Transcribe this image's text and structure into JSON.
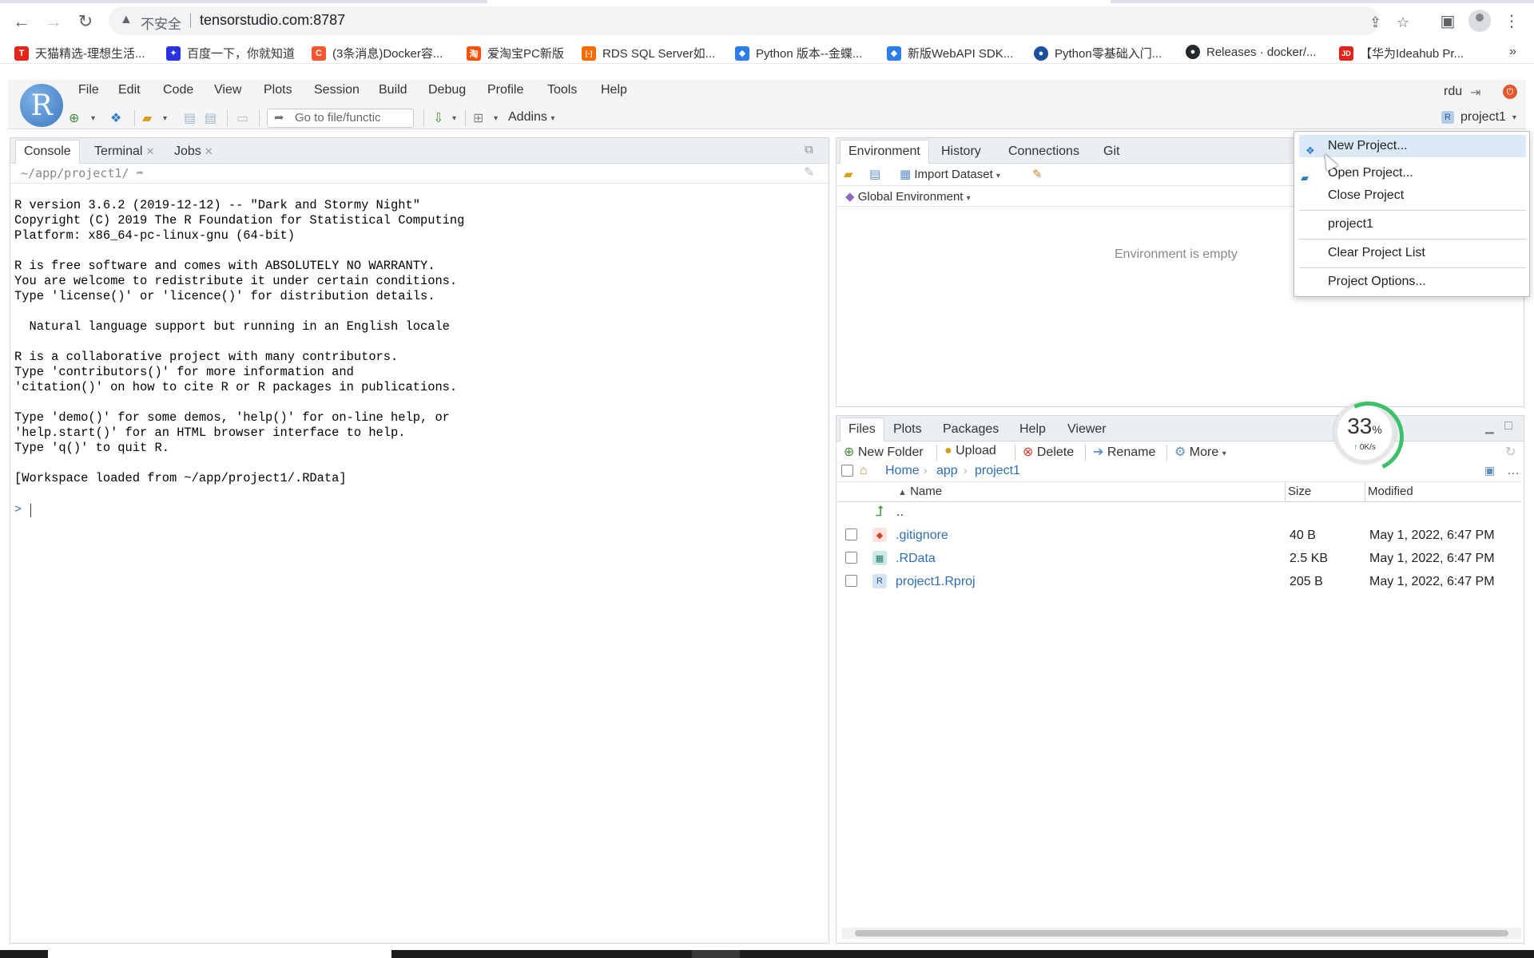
{
  "browser": {
    "insecure_label": "不安全",
    "url": "tensorstudio.com:8787",
    "bookmarks": [
      {
        "label": "天猫精选-理想生活...",
        "icon_text": "T",
        "color": "#e1251b"
      },
      {
        "label": "百度一下，你就知道",
        "icon_text": "✦",
        "color": "#2932e1"
      },
      {
        "label": "(3条消息)Docker容...",
        "icon_text": "C",
        "color": "#fc5531"
      },
      {
        "label": "爱淘宝PC新版",
        "icon_text": "淘",
        "color": "#ff5000"
      },
      {
        "label": "RDS SQL Server如...",
        "icon_text": "[-]",
        "color": "#ff6a00"
      },
      {
        "label": "Python 版本--金蝶...",
        "icon_text": "◆",
        "color": "#2b7de9"
      },
      {
        "label": "新版WebAPI SDK...",
        "icon_text": "◆",
        "color": "#2b7de9"
      },
      {
        "label": "Python零基础入门...",
        "icon_text": "●",
        "color": "#1b4fa0"
      },
      {
        "label": "Releases · docker/...",
        "icon_text": "●",
        "color": "#24292e"
      },
      {
        "label": "【华为Ideahub Pr...",
        "icon_text": "JD",
        "color": "#e1251b"
      }
    ],
    "more_bookmarks": "»"
  },
  "rstudio": {
    "logo": "R",
    "menu": [
      "File",
      "Edit",
      "Code",
      "View",
      "Plots",
      "Session",
      "Build",
      "Debug",
      "Profile",
      "Tools",
      "Help"
    ],
    "user": "rdu",
    "goto_placeholder": "Go to file/functic",
    "addins": "Addins",
    "project_name": "project1"
  },
  "console_pane": {
    "tabs": [
      {
        "label": "Console",
        "closable": false
      },
      {
        "label": "Terminal",
        "closable": true
      },
      {
        "label": "Jobs",
        "closable": true
      }
    ],
    "path": "~/app/project1/",
    "output": "R version 3.6.2 (2019-12-12) -- \"Dark and Stormy Night\"\nCopyright (C) 2019 The R Foundation for Statistical Computing\nPlatform: x86_64-pc-linux-gnu (64-bit)\n\nR is free software and comes with ABSOLUTELY NO WARRANTY.\nYou are welcome to redistribute it under certain conditions.\nType 'license()' or 'licence()' for distribution details.\n\n  Natural language support but running in an English locale\n\nR is a collaborative project with many contributors.\nType 'contributors()' for more information and\n'citation()' on how to cite R or R packages in publications.\n\nType 'demo()' for some demos, 'help()' for on-line help, or\n'help.start()' for an HTML browser interface to help.\nType 'q()' to quit R.\n\n[Workspace loaded from ~/app/project1/.RData]",
    "prompt": ">"
  },
  "env_pane": {
    "tabs": [
      "Environment",
      "History",
      "Connections",
      "Git"
    ],
    "import_dataset": "Import Dataset",
    "global_env": "Global Environment",
    "empty_message": "Environment is empty"
  },
  "files_pane": {
    "tabs": [
      "Files",
      "Plots",
      "Packages",
      "Help",
      "Viewer"
    ],
    "toolbar": {
      "new_folder": "New Folder",
      "upload": "Upload",
      "delete": "Delete",
      "rename": "Rename",
      "more": "More"
    },
    "breadcrumb": [
      "Home",
      "app",
      "project1"
    ],
    "columns": {
      "name": "Name",
      "size": "Size",
      "modified": "Modified"
    },
    "parent": "..",
    "files": [
      {
        "name": ".gitignore",
        "size": "40 B",
        "modified": "May 1, 2022, 6:47 PM"
      },
      {
        "name": ".RData",
        "size": "2.5 KB",
        "modified": "May 1, 2022, 6:47 PM"
      },
      {
        "name": "project1.Rproj",
        "size": "205 B",
        "modified": "May 1, 2022, 6:47 PM"
      }
    ]
  },
  "speed_widget": {
    "percent": "33",
    "percent_sign": "%",
    "rate": "0K/s"
  },
  "project_menu": {
    "items": [
      "New Project...",
      "Open Project...",
      "Close Project",
      "project1",
      "Clear Project List",
      "Project Options..."
    ]
  }
}
